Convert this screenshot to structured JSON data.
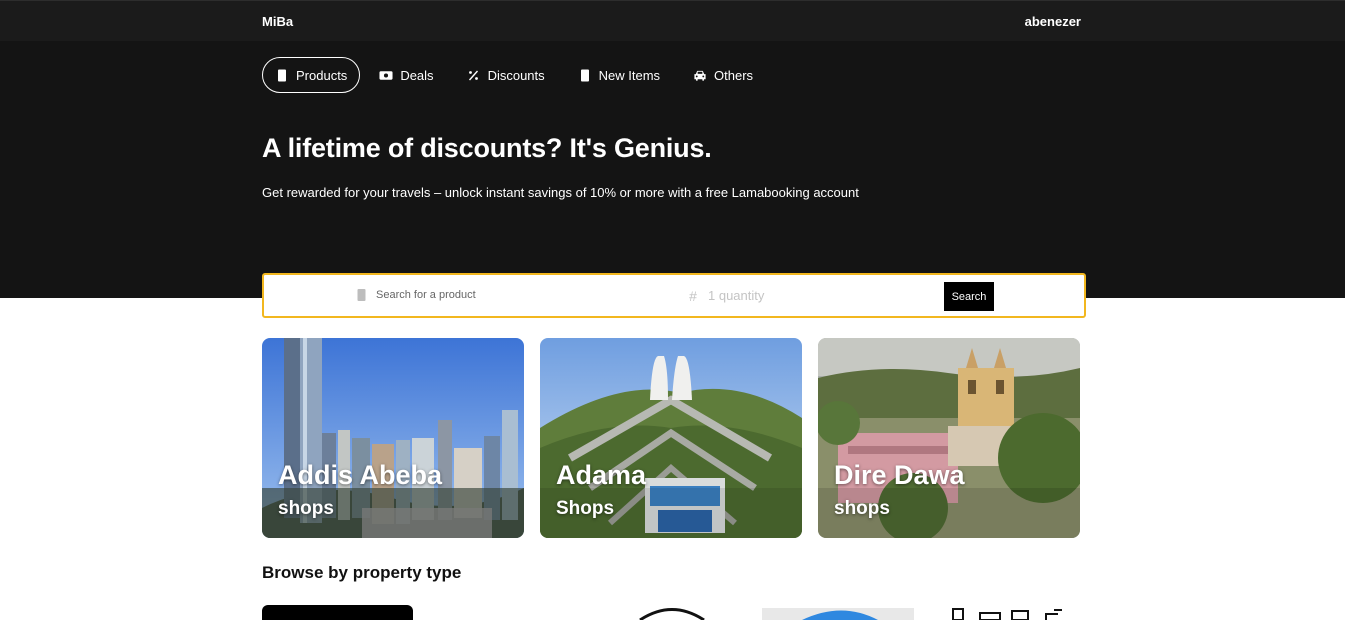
{
  "header": {
    "brand": "MiBa",
    "user": "abenezer"
  },
  "nav": {
    "items": [
      {
        "label": "Products",
        "icon": "product-icon",
        "active": true
      },
      {
        "label": "Deals",
        "icon": "money-icon",
        "active": false
      },
      {
        "label": "Discounts",
        "icon": "percent-icon",
        "active": false
      },
      {
        "label": "New Items",
        "icon": "product-icon",
        "active": false
      },
      {
        "label": "Others",
        "icon": "car-icon",
        "active": false
      }
    ]
  },
  "hero": {
    "title": "A lifetime of discounts? It's Genius.",
    "subtitle": "Get rewarded for your travels – unlock instant savings of 10% or more with a free Lamabooking account"
  },
  "search": {
    "product_placeholder": "Search for a product",
    "quantity_placeholder": "1 quantity",
    "button_label": "Search",
    "accent": "#f2b71f"
  },
  "cities": [
    {
      "name": "Addis Abeba",
      "subtitle": "shops"
    },
    {
      "name": "Adama",
      "subtitle": "Shops"
    },
    {
      "name": "Dire Dawa",
      "subtitle": "shops"
    }
  ],
  "browse": {
    "title": "Browse by property type"
  }
}
